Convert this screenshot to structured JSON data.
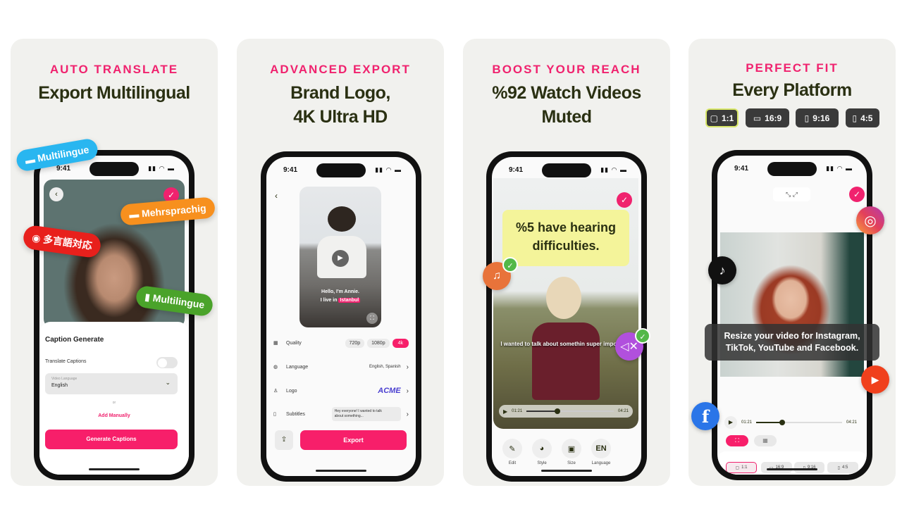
{
  "colors": {
    "accent": "#f0226e",
    "title": "#2a3012",
    "card_bg": "#f1f1ee"
  },
  "status_time": "9:41",
  "panel1": {
    "label": "AUTO TRANSLATE",
    "title": "Export Multilingual",
    "tags": [
      "Multilingue",
      "Mehrsprachig",
      "多言語対応",
      "Multilingue"
    ],
    "sheet_title": "Caption Generate",
    "toggle_label": "Translate Captions",
    "toggle_on": false,
    "dropdown_label": "Video Language",
    "dropdown_value": "English",
    "or": "or",
    "add_manually": "Add Manually",
    "generate": "Generate Captions"
  },
  "panel2": {
    "label": "ADVANCED EXPORT",
    "title_line1": "Brand Logo,",
    "title_line2": "4K Ultra HD",
    "caption_line1": "Hello, I'm Annie.",
    "caption_line2_prefix": "I live in",
    "caption_highlight": "Istanbul",
    "quality_label": "Quality",
    "quality_options": [
      "720p",
      "1080p",
      "4k"
    ],
    "quality_selected": "4k",
    "language_label": "Language",
    "language_value": "English, Spanish",
    "logo_label": "Logo",
    "logo_value": "ACME",
    "subtitles_label": "Subtitles",
    "subtitles_value": "Hey everyone! I wanted to talk about something...",
    "export": "Export"
  },
  "panel3": {
    "label": "BOOST YOUR REACH",
    "title_line1": "%92 Watch Videos",
    "title_line2": "Muted",
    "callout": "%5 have hearing difficulties.",
    "caption": "I wanted to talk about somethin super important:",
    "time_current": "01:21",
    "time_total": "04:21",
    "progress": 0.35,
    "tools": [
      {
        "icon": "edit-icon",
        "label": "Edit"
      },
      {
        "icon": "palette-icon",
        "label": "Style"
      },
      {
        "icon": "size-icon",
        "label": "Size"
      },
      {
        "icon": "EN",
        "label": "Language"
      }
    ]
  },
  "panel4": {
    "label": "PERFECT FIT",
    "title": "Every Platform",
    "ratios": [
      "1:1",
      "16:9",
      "9:16",
      "4:5"
    ],
    "ratio_selected": "1:1",
    "caption": "Resize your video for Instagram, TikTok, YouTube and Facebook.",
    "time_current": "01:21",
    "time_total": "04:21",
    "progress": 0.3,
    "social": [
      "instagram",
      "tiktok",
      "youtube",
      "facebook"
    ]
  }
}
